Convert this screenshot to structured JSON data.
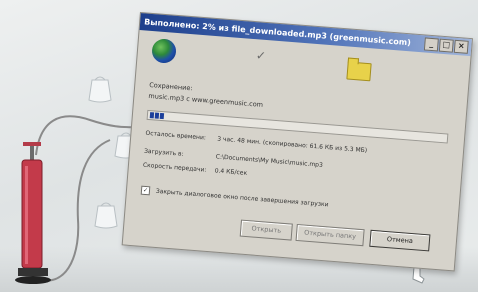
{
  "dialog": {
    "title": "Выполнено: 2% из file_downloaded.mp3 (greenmusic.com)",
    "title_buttons": [
      "_",
      "□",
      "×"
    ],
    "saving_label": "Сохранение:",
    "url": "music.mp3 с www.greenmusic.com",
    "progress_percent": 2,
    "info": [
      {
        "key": "Осталось времени:",
        "value": "3 час. 48 мин. (скопировано: 61.6 КБ из 5.3 МБ)"
      },
      {
        "key": "Загрузить в:",
        "value": "C:\\Documents\\My Music\\music.mp3"
      },
      {
        "key": "Скорость передачи:",
        "value": "0.4 КБ/сек"
      }
    ],
    "close_when_done_label": "Закрыть диалоговое окно после завершения загрузки",
    "close_when_done_checked": true,
    "buttons": {
      "open": "Открыть",
      "open_folder": "Открыть папку",
      "cancel": "Отмена"
    }
  },
  "icons": {
    "globe": "globe-icon",
    "transfer": "check-transfer-icon",
    "folder": "folder-icon"
  },
  "colors": {
    "titlebar_start": "#1d3f8c",
    "progress_fill": "#1c3f9b",
    "pump_red": "#c33a4a"
  }
}
